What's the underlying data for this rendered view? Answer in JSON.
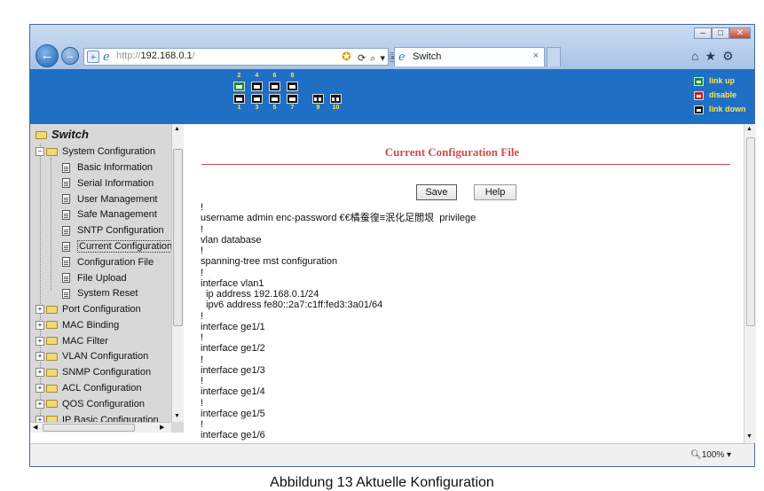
{
  "window": {
    "minimize": "–",
    "maximize": "□",
    "close": "✕"
  },
  "address": {
    "url_prefix": "http://",
    "url_host": "192.168.0.1",
    "url_suffix": "/",
    "tools": "⟳ ⌕ ▾ 🖹 ⟳ ✕"
  },
  "tab": {
    "title": "Switch",
    "close": "×"
  },
  "command_icons": "⌂★⚙",
  "ports": {
    "top_numbers": [
      "2",
      "4",
      "6",
      "8"
    ],
    "bottom_numbers": [
      "1",
      "3",
      "5",
      "7",
      "9",
      "10"
    ],
    "status": {
      "1": "link-down",
      "2": "link-up",
      "3": "link-down",
      "4": "link-down",
      "5": "link-down",
      "6": "link-down",
      "7": "link-down",
      "8": "link-down",
      "9": "link-down",
      "10": "link-down"
    }
  },
  "legend": {
    "link_up": "link up",
    "disable": "disable",
    "link_down": "link down",
    "colors": {
      "link_up": "#0c8e34",
      "disable": "#c81e1e",
      "link_down": "#111111"
    }
  },
  "sidebar": {
    "root": "Switch",
    "system_configuration": "System Configuration",
    "system_items": [
      "Basic Information",
      "Serial Information",
      "User Management",
      "Safe Management",
      "SNTP Configuration",
      "Current Configuration",
      "Configuration File",
      "File Upload",
      "System Reset"
    ],
    "selected_item": "Current Configuration",
    "folders": [
      "Port Configuration",
      "MAC Binding",
      "MAC Filter",
      "VLAN Configuration",
      "SNMP Configuration",
      "ACL Configuration",
      "QOS Configuration",
      "IP Basic Configuration"
    ]
  },
  "main": {
    "title": "Current Configuration File",
    "save_label": "Save",
    "help_label": "Help",
    "config_text": "!\nusername admin enc-password €€橘蚕徨≡泯化足閻垠  privilege\n!\nvlan database\n!\nspanning-tree mst configuration\n!\ninterface vlan1\n  ip address 192.168.0.1/24\n  ipv6 address fe80::2a7:c1ff:fed3:3a01/64\n!\ninterface ge1/1\n!\ninterface ge1/2\n!\ninterface ge1/3\n!\ninterface ge1/4\n!\ninterface ge1/5\n!\ninterface ge1/6"
  },
  "status": {
    "zoom": "100%"
  },
  "caption": "Abbildung 13 Aktuelle Konfiguration",
  "colors": {
    "banner": "#1f6fc5",
    "title_red": "#d24a4a",
    "legend_text": "#ffe54a"
  }
}
